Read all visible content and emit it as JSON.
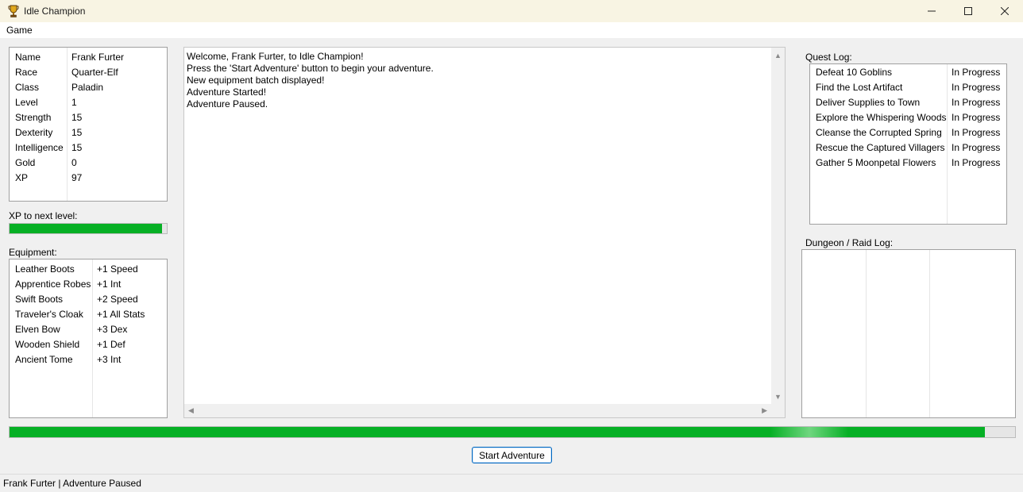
{
  "window": {
    "title": "Idle Champion",
    "icon": "trophy-icon",
    "controls": [
      "minimize-icon",
      "maximize-icon",
      "close-icon"
    ]
  },
  "menu": {
    "items": [
      "Game"
    ]
  },
  "character": {
    "rows": [
      {
        "label": "Name",
        "value": "Frank Furter"
      },
      {
        "label": "Race",
        "value": "Quarter-Elf"
      },
      {
        "label": "Class",
        "value": "Paladin"
      },
      {
        "label": "Level",
        "value": "1"
      },
      {
        "label": "Strength",
        "value": "15"
      },
      {
        "label": "Dexterity",
        "value": "15"
      },
      {
        "label": "Intelligence",
        "value": "15"
      },
      {
        "label": "Gold",
        "value": "0"
      },
      {
        "label": "XP",
        "value": "97"
      }
    ]
  },
  "xp": {
    "label": "XP to next level:",
    "progress_fraction": 0.97,
    "fill_color": "#06b025"
  },
  "equipment": {
    "label": "Equipment:",
    "rows": [
      {
        "item": "Leather Boots",
        "bonus": "+1 Speed"
      },
      {
        "item": "Apprentice Robes",
        "bonus": "+1 Int"
      },
      {
        "item": "Swift Boots",
        "bonus": "+2 Speed"
      },
      {
        "item": "Traveler's Cloak",
        "bonus": "+1 All Stats"
      },
      {
        "item": "Elven Bow",
        "bonus": "+3 Dex"
      },
      {
        "item": "Wooden Shield",
        "bonus": "+1 Def"
      },
      {
        "item": "Ancient Tome",
        "bonus": "+3 Int"
      }
    ]
  },
  "log": {
    "lines": [
      "Welcome, Frank Furter, to Idle Champion!",
      "Press the 'Start Adventure' button to begin your adventure.",
      "New equipment batch displayed!",
      "Adventure Started!",
      "Adventure Paused."
    ]
  },
  "quest_log": {
    "label": "Quest Log:",
    "rows": [
      {
        "name": "Defeat 10 Goblins",
        "status": "In Progress"
      },
      {
        "name": "Find the Lost Artifact",
        "status": "In Progress"
      },
      {
        "name": "Deliver Supplies to Town",
        "status": "In Progress"
      },
      {
        "name": "Explore the Whispering Woods",
        "status": "In Progress"
      },
      {
        "name": "Cleanse the Corrupted Spring",
        "status": "In Progress"
      },
      {
        "name": "Rescue the Captured Villagers",
        "status": "In Progress"
      },
      {
        "name": "Gather 5 Moonpetal Flowers",
        "status": "In Progress"
      }
    ]
  },
  "dungeon_log": {
    "label": "Dungeon / Raid Log:"
  },
  "adventure_progress": {
    "progress_fraction": 0.97,
    "fill_color": "#06b025"
  },
  "start_button": {
    "label": "Start Adventure"
  },
  "status": {
    "text": "Frank Furter | Adventure Paused"
  }
}
